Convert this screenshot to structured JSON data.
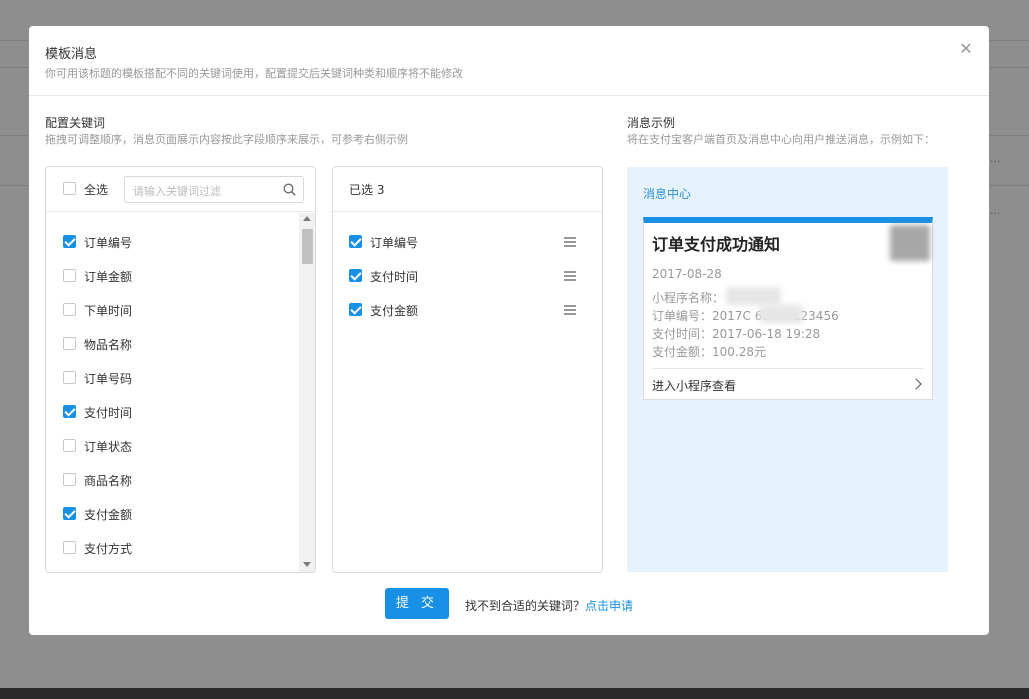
{
  "background": {
    "frag1": "...",
    "frag2": "..."
  },
  "modal": {
    "title": "模板消息",
    "subtitle": "你可用该标题的模板搭配不同的关键词使用，配置提交后关键词种类和顺序将不能修改",
    "close_icon": "close-icon"
  },
  "config": {
    "title": "配置关键词",
    "desc": "拖拽可调整顺序，消息页面展示内容按此字段顺序来展示，可参考右侧示例"
  },
  "left_panel": {
    "select_all": "全选",
    "search_placeholder": "请输入关键词过滤",
    "items": [
      {
        "label": "订单编号",
        "checked": true
      },
      {
        "label": "订单金额",
        "checked": false
      },
      {
        "label": "下单时间",
        "checked": false
      },
      {
        "label": "物品名称",
        "checked": false
      },
      {
        "label": "订单号码",
        "checked": false
      },
      {
        "label": "支付时间",
        "checked": true
      },
      {
        "label": "订单状态",
        "checked": false
      },
      {
        "label": "商品名称",
        "checked": false
      },
      {
        "label": "支付金额",
        "checked": true
      },
      {
        "label": "支付方式",
        "checked": false
      }
    ]
  },
  "right_panel": {
    "header": "已选 3",
    "items": [
      {
        "label": "订单编号",
        "checked": true
      },
      {
        "label": "支付时间",
        "checked": true
      },
      {
        "label": "支付金额",
        "checked": true
      }
    ]
  },
  "example": {
    "title": "消息示例",
    "desc": "将在支付宝客户端首页及消息中心向用户推送消息，示例如下：",
    "header": "消息中心",
    "card_title": "订单支付成功通知",
    "date": "2017-08-28",
    "lines": [
      "小程序名称：",
      "订单编号：2017C        62645123456",
      "支付时间：2017-06-18 19:28",
      "支付金额：100.28元"
    ],
    "link": "进入小程序查看"
  },
  "footer": {
    "submit": "提 交",
    "hint": "找不到合适的关键词？",
    "link": "点击申请"
  },
  "colors": {
    "accent": "#1890e6",
    "preview_bg": "#e7f3fc"
  }
}
